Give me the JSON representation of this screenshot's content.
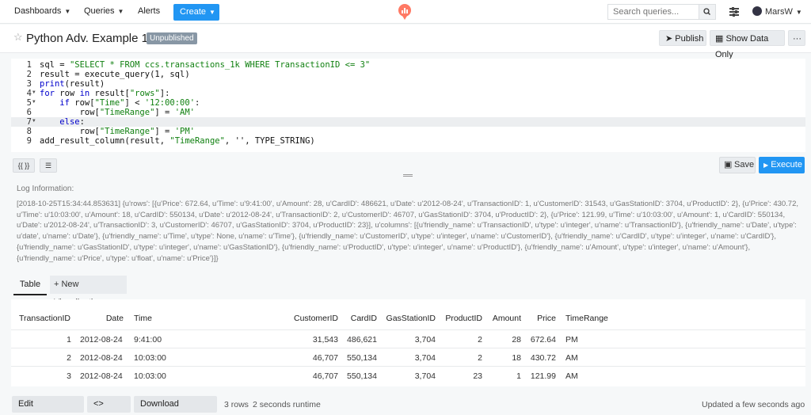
{
  "nav": {
    "dashboards": "Dashboards",
    "queries": "Queries",
    "alerts": "Alerts",
    "create": "Create",
    "search_placeholder": "Search queries...",
    "user": "MarsW"
  },
  "header": {
    "title": "Python Adv. Example 1",
    "badge": "Unpublished",
    "publish": "Publish",
    "show_data_only": "Show Data Only",
    "more": "···"
  },
  "editor": {
    "lines": [
      {
        "n": "1",
        "code": "sql = \"SELECT * FROM ccs.transactions_1k WHERE TransactionID <= 3\""
      },
      {
        "n": "2",
        "code": "result = execute_query(1, sql)"
      },
      {
        "n": "3",
        "code": "print(result)"
      },
      {
        "n": "4",
        "code": "for row in result[\"rows\"]:"
      },
      {
        "n": "5",
        "code": "    if row[\"Time\"] < '12:00:00':"
      },
      {
        "n": "6",
        "code": "        row[\"TimeRange\"] = 'AM'"
      },
      {
        "n": "7",
        "code": "    else:"
      },
      {
        "n": "8",
        "code": "        row[\"TimeRange\"] = 'PM'"
      },
      {
        "n": "9",
        "code": "add_result_column(result, \"TimeRange\", '', TYPE_STRING)"
      }
    ]
  },
  "toolbar": {
    "params": "{{ }}",
    "save": "Save",
    "execute": "Execute"
  },
  "log": {
    "label": "Log Information:",
    "text": "[2018-10-25T15:34:44.853631] {u'rows': [{u'Price': 672.64, u'Time': u'9:41:00', u'Amount': 28, u'CardID': 486621, u'Date': u'2012-08-24', u'TransactionID': 1, u'CustomerID': 31543, u'GasStationID': 3704, u'ProductID': 2}, {u'Price': 430.72, u'Time': u'10:03:00', u'Amount': 18, u'CardID': 550134, u'Date': u'2012-08-24', u'TransactionID': 2, u'CustomerID': 46707, u'GasStationID': 3704, u'ProductID': 2}, {u'Price': 121.99, u'Time': u'10:03:00', u'Amount': 1, u'CardID': 550134, u'Date': u'2012-08-24', u'TransactionID': 3, u'CustomerID': 46707, u'GasStationID': 3704, u'ProductID': 23}], u'columns': [{u'friendly_name': u'TransactionID', u'type': u'integer', u'name': u'TransactionID'}, {u'friendly_name': u'Date', u'type': u'date', u'name': u'Date'}, {u'friendly_name': u'Time', u'type': None, u'name': u'Time'}, {u'friendly_name': u'CustomerID', u'type': u'integer', u'name': u'CustomerID'}, {u'friendly_name': u'CardID', u'type': u'integer', u'name': u'CardID'}, {u'friendly_name': u'GasStationID', u'type': u'integer', u'name': u'GasStationID'}, {u'friendly_name': u'ProductID', u'type': u'integer', u'name': u'ProductID'}, {u'friendly_name': u'Amount', u'type': u'integer', u'name': u'Amount'}, {u'friendly_name': u'Price', u'type': u'float', u'name': u'Price'}]}"
  },
  "tabs": {
    "table": "Table",
    "new_viz": "+ New Visualization"
  },
  "table": {
    "columns": [
      "TransactionID",
      "Date",
      "Time",
      "CustomerID",
      "CardID",
      "GasStationID",
      "ProductID",
      "Amount",
      "Price",
      "TimeRange"
    ],
    "rows": [
      [
        "1",
        "2012-08-24",
        "9:41:00",
        "31,543",
        "486,621",
        "3,704",
        "2",
        "28",
        "672.64",
        "PM"
      ],
      [
        "2",
        "2012-08-24",
        "10:03:00",
        "46,707",
        "550,134",
        "3,704",
        "2",
        "18",
        "430.72",
        "AM"
      ],
      [
        "3",
        "2012-08-24",
        "10:03:00",
        "46,707",
        "550,134",
        "3,704",
        "23",
        "1",
        "121.99",
        "AM"
      ]
    ]
  },
  "footer": {
    "edit_viz": "Edit Visualization",
    "embed": "<> Embed",
    "download": "Download Dataset",
    "rows": "3 rows",
    "runtime": "2 seconds runtime",
    "updated": "Updated a few seconds ago"
  }
}
